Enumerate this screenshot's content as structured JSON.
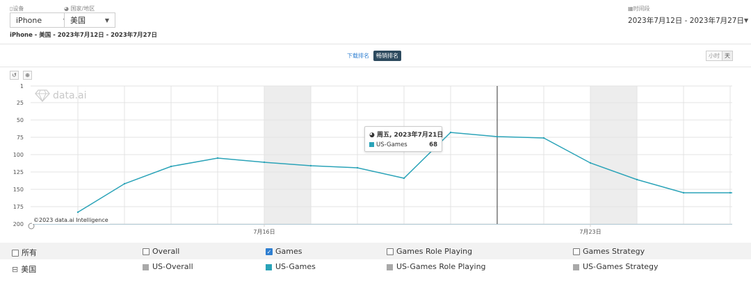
{
  "filters": {
    "device_label": "设备",
    "device_value": "iPhone",
    "country_label": "国家/地区",
    "country_value": "美国",
    "period_label": "时间段",
    "period_value": "2023年7月12日 - 2023年7月27日"
  },
  "subtitle": "iPhone - 美国 - 2023年7月12日 - 2023年7月27日",
  "tabs": {
    "downloads": "下载排名",
    "grossing": "畅销排名"
  },
  "granularity": {
    "hour": "小时",
    "day": "天"
  },
  "watermark": "data.ai",
  "copyright": "©2023 data.ai Intelligence",
  "tooltip": {
    "date": "周五, 2023年7月21日",
    "series": "US-Games",
    "value": "68"
  },
  "legend": {
    "all": "所有",
    "country": "美国",
    "series": [
      {
        "name": "Overall",
        "item": "US-Overall",
        "checked": false,
        "color": "#a9a9a9"
      },
      {
        "name": "Games",
        "item": "US-Games",
        "checked": true,
        "color": "#2aa3b8"
      },
      {
        "name": "Games Role Playing",
        "item": "US-Games Role Playing",
        "checked": false,
        "color": "#a9a9a9"
      },
      {
        "name": "Games Strategy",
        "item": "US-Games Strategy",
        "checked": false,
        "color": "#a9a9a9"
      }
    ]
  },
  "chart_data": {
    "type": "line",
    "x": [
      "2023-07-12",
      "2023-07-13",
      "2023-07-14",
      "2023-07-15",
      "2023-07-16",
      "2023-07-17",
      "2023-07-18",
      "2023-07-19",
      "2023-07-20",
      "2023-07-21",
      "2023-07-22",
      "2023-07-23",
      "2023-07-24",
      "2023-07-25",
      "2023-07-26",
      "2023-07-27"
    ],
    "xticks": [
      {
        "date": "2023-07-16",
        "label": "7月16日"
      },
      {
        "date": "2023-07-23",
        "label": "7月23日"
      }
    ],
    "weekend_bands": [
      [
        "2023-07-15",
        "2023-07-16"
      ],
      [
        "2023-07-22",
        "2023-07-23"
      ]
    ],
    "hover_date": "2023-07-21",
    "yticks": [
      1,
      25,
      50,
      75,
      100,
      125,
      150,
      175,
      200
    ],
    "ylim": [
      1,
      200
    ],
    "y_reversed": true,
    "grid": true,
    "series": [
      {
        "name": "US-Games",
        "color": "#2aa3b8",
        "values": [
          183,
          142,
          117,
          105,
          111,
          116,
          119,
          134,
          68,
          74,
          76,
          112,
          136,
          155,
          155,
          null
        ]
      }
    ]
  }
}
